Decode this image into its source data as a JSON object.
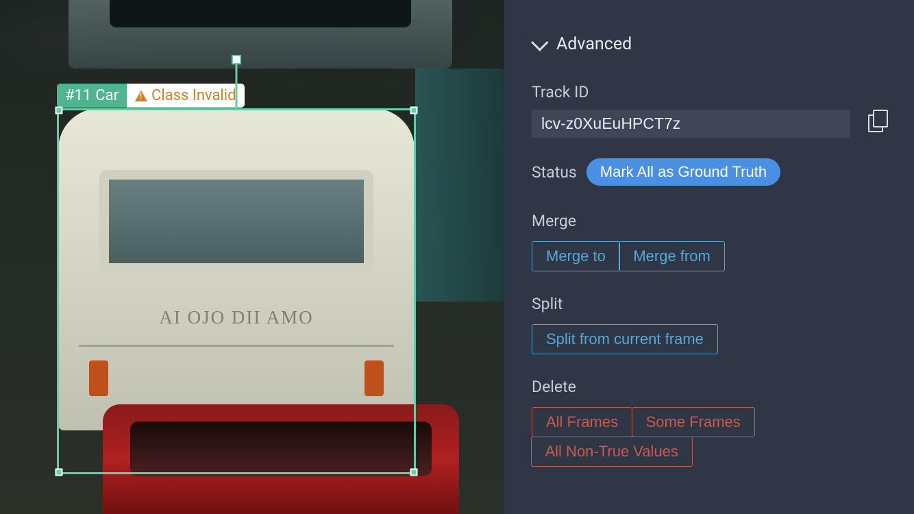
{
  "annotation": {
    "id_tag": "#11",
    "class_label": "Car",
    "warning": "Class Invalid"
  },
  "van_text": "AI OJO DII AMO",
  "panel": {
    "section_title": "Advanced",
    "track_id": {
      "label": "Track ID",
      "value": "lcv-z0XuEuHPCT7z"
    },
    "status": {
      "label": "Status",
      "action": "Mark All as Ground Truth"
    },
    "merge": {
      "label": "Merge",
      "merge_to": "Merge to",
      "merge_from": "Merge from"
    },
    "split": {
      "label": "Split",
      "action": "Split from current frame"
    },
    "delete": {
      "label": "Delete",
      "all_frames": "All Frames",
      "some_frames": "Some Frames",
      "all_non_true": "All Non-True Values"
    }
  }
}
